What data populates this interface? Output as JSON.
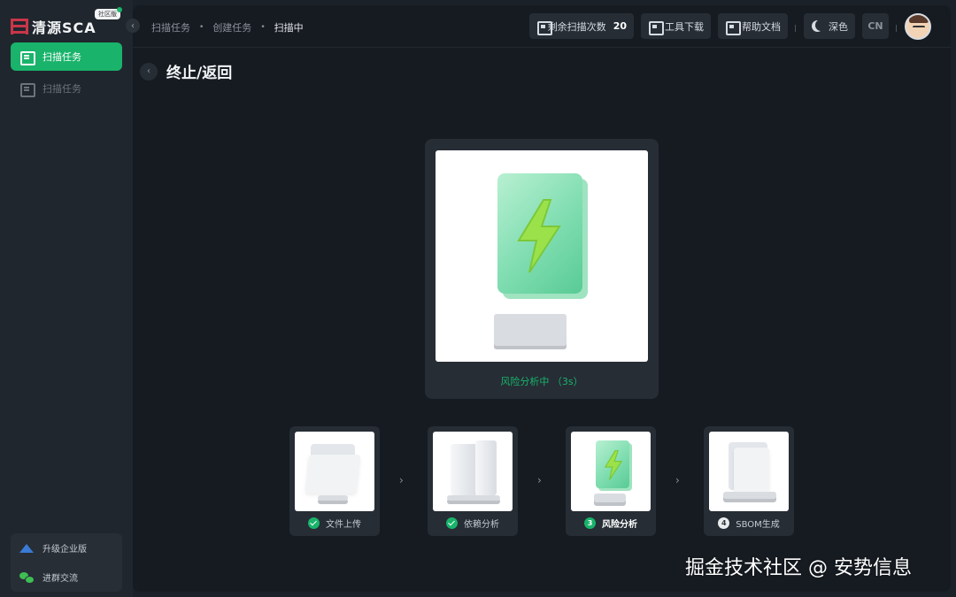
{
  "app": {
    "logo_text": "清源SCA",
    "logo_badge": "社区版"
  },
  "sidebar": {
    "items": [
      {
        "label": "扫描任务",
        "active": true
      },
      {
        "label": "扫描任务",
        "active": false
      }
    ],
    "bottom": [
      {
        "label": "升级企业版",
        "icon": "crown-icon"
      },
      {
        "label": "进群交流",
        "icon": "wechat-icon"
      }
    ]
  },
  "breadcrumb": {
    "items": [
      "扫描任务",
      "创建任务",
      "扫描中"
    ],
    "separator": "•"
  },
  "toolbar": {
    "remaining_label": "剩余扫描次数",
    "remaining_count": "20",
    "download_label": "工具下载",
    "help_label": "帮助文档",
    "theme_label": "深色",
    "lang_label": "CN"
  },
  "page": {
    "back_icon": "‹",
    "title": "终止/返回"
  },
  "hero": {
    "status": "风险分析中 （3s）"
  },
  "steps": [
    {
      "label": "文件上传",
      "state": "done"
    },
    {
      "label": "依赖分析",
      "state": "done"
    },
    {
      "label": "风险分析",
      "state": "active",
      "number": "3"
    },
    {
      "label": "SBOM生成",
      "state": "todo",
      "number": "4"
    }
  ],
  "step_arrow": "›",
  "watermark": "掘金技术社区 @ 安势信息",
  "colors": {
    "accent": "#19b36b",
    "background": "#1b2128",
    "panel": "#161b21",
    "card": "#262d35"
  }
}
